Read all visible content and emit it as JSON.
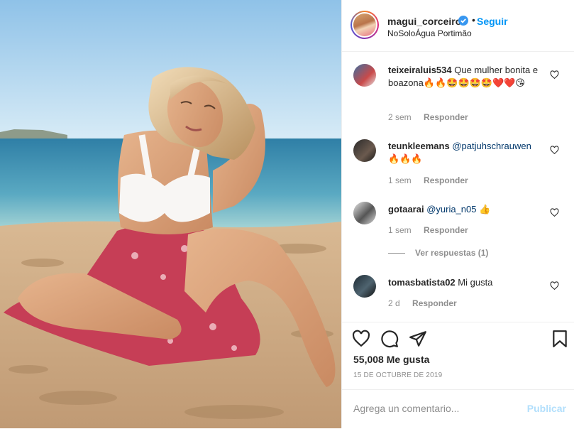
{
  "post": {
    "username": "magui_corceiro",
    "follow_label": "Seguir",
    "separator": "•",
    "location": "NoSoloÁgua Portimão"
  },
  "comments": [
    {
      "user": "teixeiraluis534",
      "text": "Que mulher bonita e boazona",
      "emojis": "🔥🔥🤩🤩🤩🤩❤️❤️😘",
      "time": "2 sem",
      "reply": "Responder"
    },
    {
      "user": "teunkleemans",
      "mention": "@patjuhschrauwen",
      "emojis": "🔥🔥🔥",
      "time": "1 sem",
      "reply": "Responder"
    },
    {
      "user": "gotaarai",
      "mention": "@yuria_n05",
      "emojis": "👍",
      "time": "1 sem",
      "reply": "Responder",
      "view_replies": "Ver respuestas (1)"
    },
    {
      "user": "tomasbatista02",
      "text": "Mi gusta",
      "time": "2 d",
      "reply": "Responder"
    }
  ],
  "stats": {
    "likes": "55,008 Me gusta",
    "date": "15 DE OCTUBRE DE 2019"
  },
  "composer": {
    "placeholder": "Agrega un comentario...",
    "publish_label": "Publicar"
  },
  "icons": {
    "verified": "verified-badge-icon",
    "like": "heart-icon",
    "comment": "comment-bubble-icon",
    "share": "paper-plane-icon",
    "save": "bookmark-icon"
  },
  "colors": {
    "link_blue": "#0095f6",
    "text": "#262626",
    "muted": "#8e8e8e",
    "publish_disabled": "#b2dffc"
  }
}
